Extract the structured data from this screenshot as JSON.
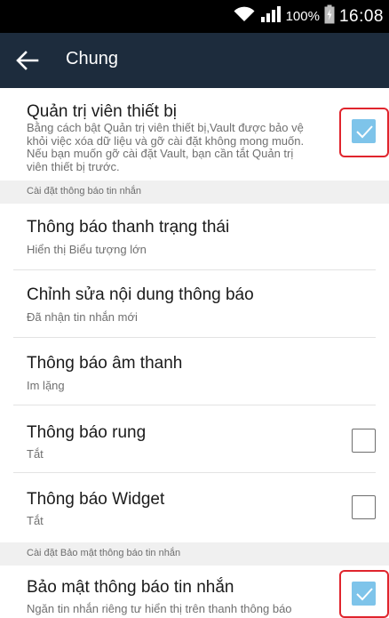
{
  "status_bar": {
    "battery": "100%",
    "time": "16:08",
    "icons": [
      "wifi-icon",
      "signal-icon",
      "battery-icon"
    ]
  },
  "app_bar": {
    "title": "Chung",
    "back_icon": "arrow-left-icon",
    "background": "#1d2c3d"
  },
  "device_admin": {
    "title": "Quản trị viên thiết bị",
    "description_lines": [
      "Bằng cách bật Quản trị viên thiết bị,Vault được bảo vệ",
      "khỏi việc xóa dữ liệu và gỡ cài đặt không mong muốn.",
      "Nếu bạn muốn gỡ cài đặt Vault, bạn cần tắt Quản trị",
      "viên thiết bị trước."
    ],
    "checked": true
  },
  "section_notifications": {
    "label": "Cài đặt thông báo tin nhắn"
  },
  "settings": [
    {
      "title": "Thông báo thanh trạng thái",
      "subtitle": "Hiển thị Biểu tượng lớn"
    },
    {
      "title": "Chỉnh sửa nội dung thông báo",
      "subtitle": "Đã nhận tin nhắn mới"
    },
    {
      "title": "Thông báo âm thanh",
      "subtitle": "Im lặng"
    },
    {
      "title": "Thông báo rung",
      "subtitle": "Tắt",
      "checked": false
    },
    {
      "title": "Thông báo Widget",
      "subtitle": "Tắt",
      "checked": false
    }
  ],
  "section_security": {
    "label": "Cài đặt Bảo mật thông báo tin nhắn"
  },
  "security": {
    "title": "Bảo mật thông báo tin nhắn",
    "subtitle": "Ngăn tin nhắn riêng tư hiển thị trên thanh thông báo",
    "checked": true
  },
  "colors": {
    "checkbox_checked": "#7ec4ea",
    "highlight": "#e0252d"
  }
}
